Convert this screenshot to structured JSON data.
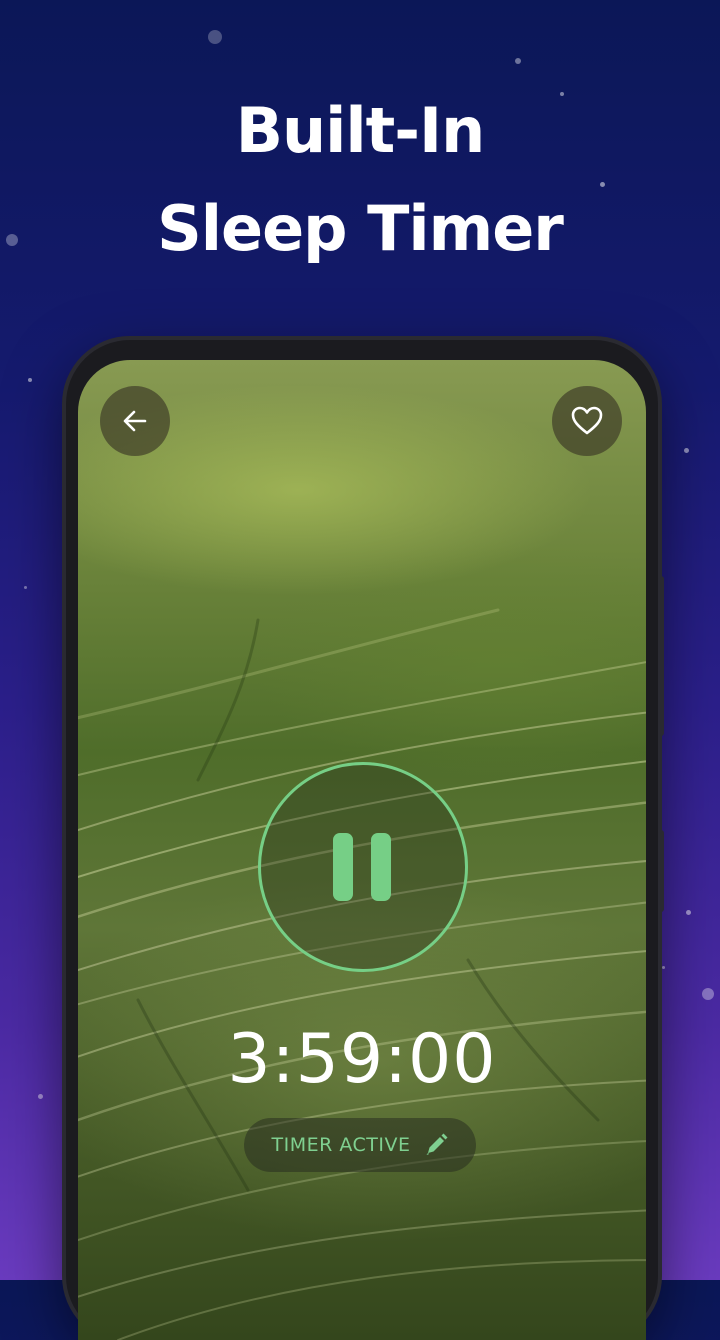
{
  "headline": {
    "line1": "Built-In",
    "line2": "Sleep Timer"
  },
  "player": {
    "back_icon": "arrow-left-icon",
    "favorite_icon": "heart-outline-icon",
    "play_state_icon": "pause-icon",
    "timer_value": "3:59:00",
    "timer_status": "TIMER ACTIVE",
    "edit_icon": "pencil-icon"
  },
  "colors": {
    "accent": "#76cf86",
    "background_top": "#0b1757",
    "background_bottom": "#6a3bbf"
  }
}
